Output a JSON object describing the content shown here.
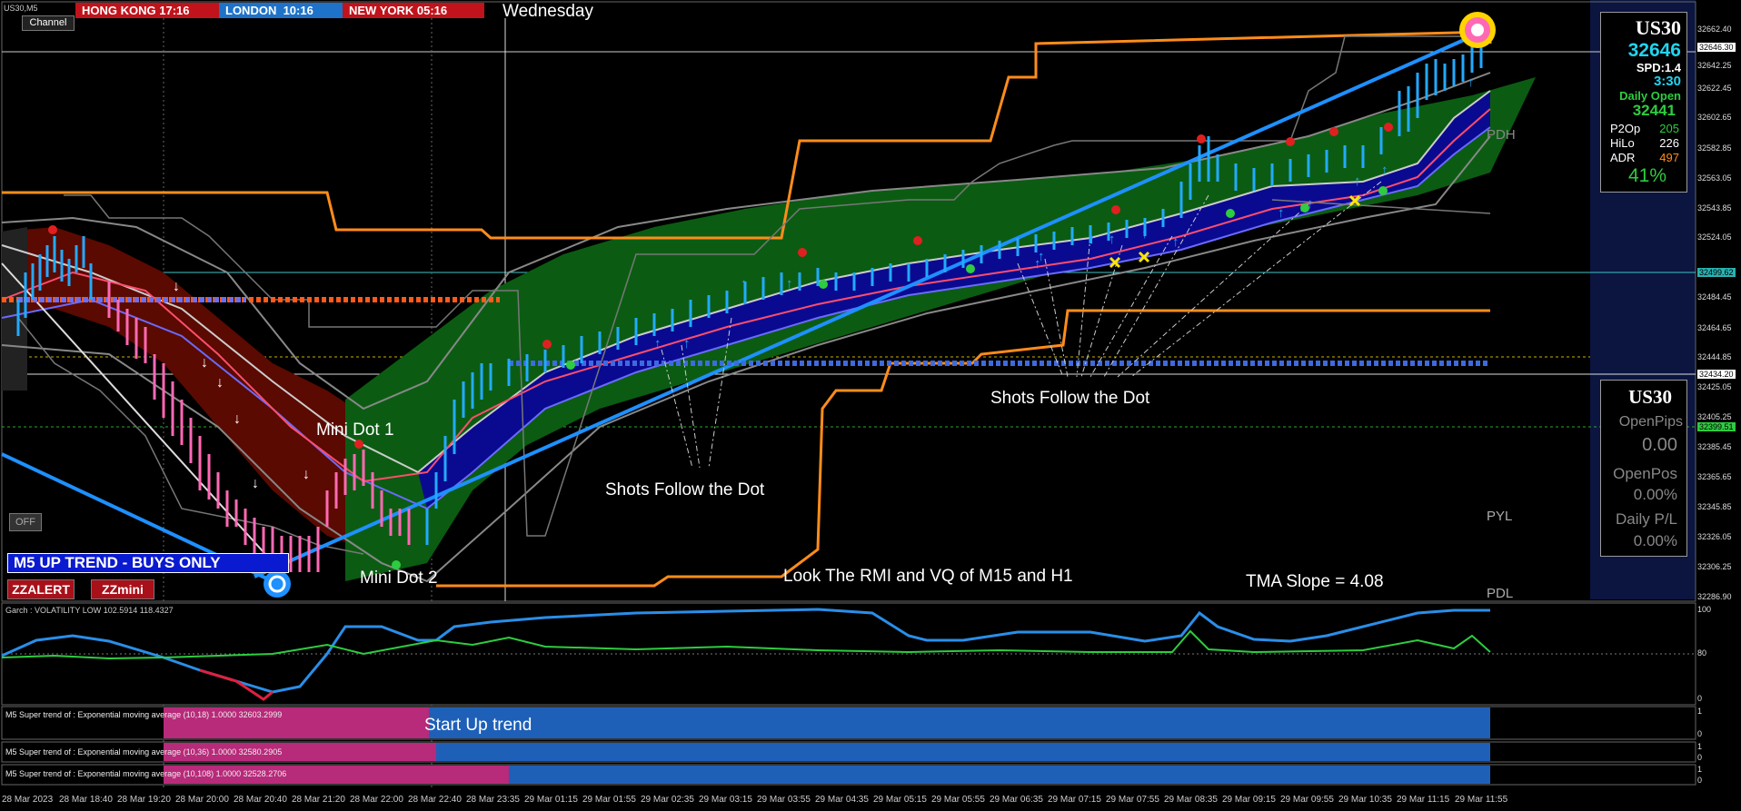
{
  "symbol_tag": "US30,M5",
  "channel_button": "Channel",
  "clocks": [
    {
      "label": "HONG KONG",
      "time": "17:16",
      "color": "#c0131b"
    },
    {
      "label": "LONDON",
      "time": "10:16",
      "color": "#1e72c8"
    },
    {
      "label": "NEW YORK",
      "time": "05:16",
      "color": "#c0131b"
    }
  ],
  "day_label": "Wednesday",
  "off_button": "OFF",
  "trend_banner": "M5 UP TREND - BUYS ONLY",
  "buttons": {
    "zzalert": "ZZALERT",
    "zzmini": "ZZmini"
  },
  "annotations": {
    "mini_dot_1": "Mini Dot 1",
    "mini_dot_2": "Mini Dot 2",
    "shots_1": "Shots Follow the Dot",
    "shots_2": "Shots Follow the Dot",
    "look": "Look The RMI and VQ of M15 and H1",
    "tma_slope": "TMA Slope = 4.08",
    "start_up_trend": "Start Up trend"
  },
  "level_labels": {
    "pdh": "PDH",
    "pyl": "PYL",
    "pdl": "PDL"
  },
  "info_panel": {
    "symbol": "US30",
    "price": "32646",
    "spread": "SPD:1.4",
    "timer": "3:30",
    "daily_open_label": "Daily Open",
    "daily_open": "32441",
    "p2op_label": "P2Op",
    "p2op": "205",
    "hilo_label": "HiLo",
    "hilo": "226",
    "adr_label": "ADR",
    "adr": "497",
    "pct": "41%"
  },
  "pos_panel": {
    "symbol": "US30",
    "open_pips_label": "OpenPips",
    "open_pips": "0.00",
    "open_pos_label": "OpenPos",
    "open_pos": "0.00%",
    "daily_pl_label": "Daily P/L",
    "daily_pl": "0.00%"
  },
  "price_axis": [
    "32662.40",
    "32642.25",
    "32622.45",
    "32602.65",
    "32582.85",
    "32563.05",
    "32543.85",
    "32524.05",
    "32504.25",
    "32484.45",
    "32464.65",
    "32444.85",
    "32425.05",
    "32405.25",
    "32385.45",
    "32365.65",
    "32345.85",
    "32326.05",
    "32306.25",
    "32286.90"
  ],
  "price_markers": {
    "top": "32646.30",
    "cyan": "32499.62",
    "white": "32434.20",
    "green": "32399.51"
  },
  "garch_label": "Garch : VOLATILITY LOW 102.5914 118.4327",
  "garch_axis": [
    "100",
    "80",
    "0"
  ],
  "supertrend_rows": [
    "M5  Super trend of : Exponential moving average (10,18)  1.0000  32603.2999",
    "M5  Super trend of : Exponential moving average (10,36)  1.0000  32580.2905",
    "M5  Super trend of : Exponential moving average (10,108)  1.0000  32528.2706"
  ],
  "supertrend_axis": [
    "1",
    "0",
    "1",
    "0",
    "1",
    "0"
  ],
  "time_axis": [
    "28 Mar 2023",
    "28 Mar 18:40",
    "28 Mar 19:20",
    "28 Mar 20:00",
    "28 Mar 20:40",
    "28 Mar 21:20",
    "28 Mar 22:00",
    "28 Mar 22:40",
    "28 Mar 23:35",
    "29 Mar 01:15",
    "29 Mar 01:55",
    "29 Mar 02:35",
    "29 Mar 03:15",
    "29 Mar 03:55",
    "29 Mar 04:35",
    "29 Mar 05:15",
    "29 Mar 05:55",
    "29 Mar 06:35",
    "29 Mar 07:15",
    "29 Mar 07:55",
    "29 Mar 08:35",
    "29 Mar 09:15",
    "29 Mar 09:55",
    "29 Mar 10:35",
    "29 Mar 11:15",
    "29 Mar 11:55"
  ],
  "colors": {
    "orange": "#ff8c1a",
    "green_fill": "#0b5c12",
    "blue_fill": "#0a0a90",
    "red_fill": "#5a0a00",
    "trend_blue": "#1e90ff",
    "sell_pink": "#ff69b4",
    "buy_cyan": "#22aaff"
  }
}
